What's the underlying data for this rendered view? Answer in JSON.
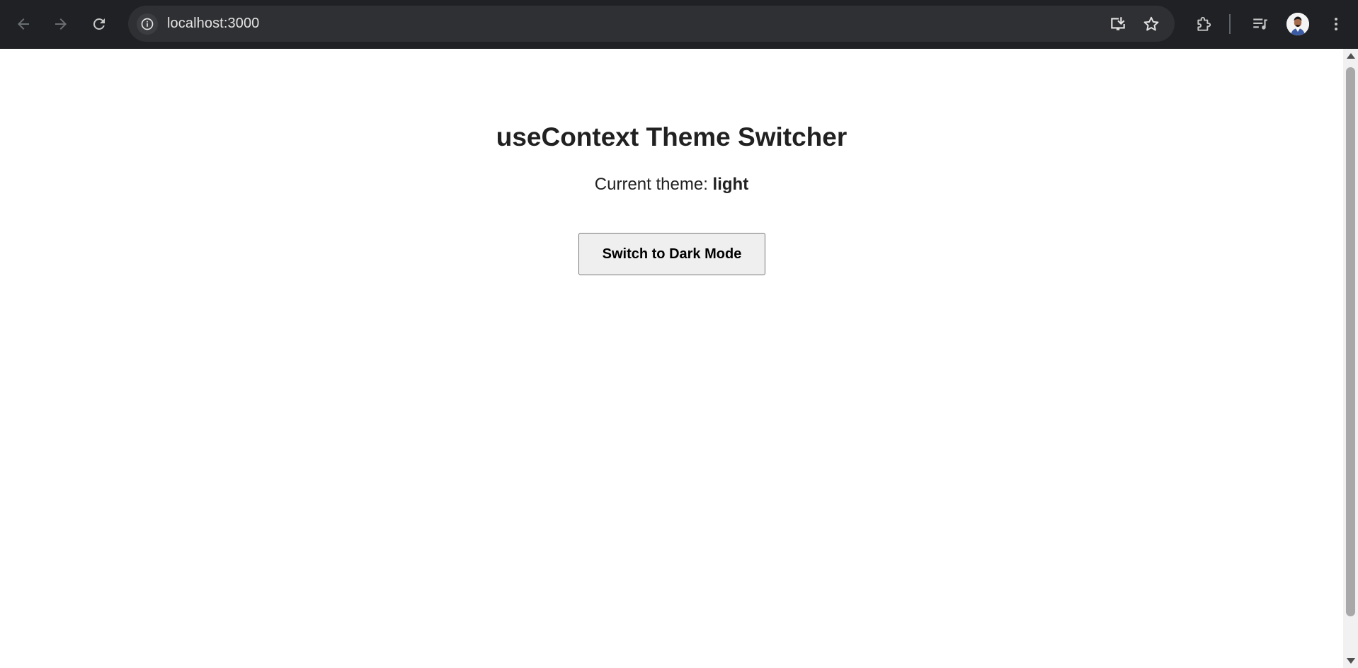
{
  "browser": {
    "url": "localhost:3000",
    "icons": {
      "back": "arrow-left-icon",
      "forward": "arrow-right-icon",
      "reload": "reload-icon",
      "site_info": "info-icon",
      "install": "install-app-icon",
      "bookmark": "star-icon",
      "extensions": "puzzle-icon",
      "media": "media-controls-icon",
      "profile": "avatar",
      "menu": "kebab-menu-icon"
    },
    "colors": {
      "toolbar_bg": "#202124",
      "omnibox_bg": "#2f3033",
      "icon": "#c4c7c5"
    }
  },
  "page": {
    "title": "useContext Theme Switcher",
    "theme_label": "Current theme: ",
    "theme_value": "light",
    "toggle_button_label": "Switch to Dark Mode"
  }
}
